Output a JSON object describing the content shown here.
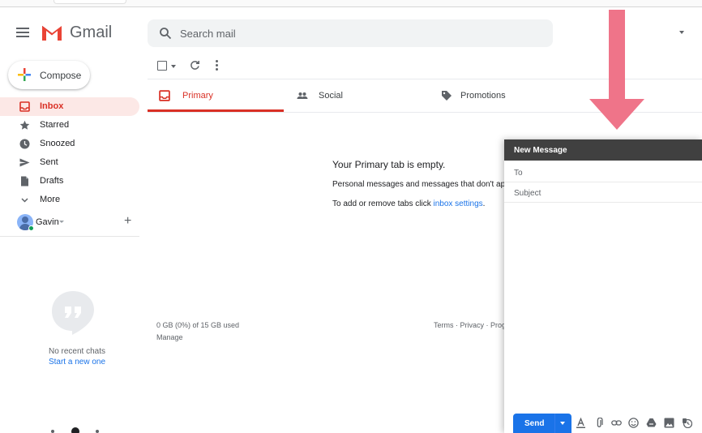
{
  "app": {
    "name": "Gmail"
  },
  "search": {
    "placeholder": "Search mail"
  },
  "compose_button": {
    "label": "Compose"
  },
  "sidebar": {
    "items": [
      {
        "label": "Inbox",
        "icon": "inbox-icon",
        "active": true
      },
      {
        "label": "Starred",
        "icon": "star-icon"
      },
      {
        "label": "Snoozed",
        "icon": "clock-icon"
      },
      {
        "label": "Sent",
        "icon": "send-icon"
      },
      {
        "label": "Drafts",
        "icon": "draft-icon"
      },
      {
        "label": "More",
        "icon": "chevron-down-icon"
      }
    ],
    "user": {
      "name": "Gavin"
    }
  },
  "hangouts": {
    "no_chats": "No recent chats",
    "start_new": "Start a new one"
  },
  "tabs": [
    {
      "label": "Primary",
      "icon": "inbox-icon"
    },
    {
      "label": "Social",
      "icon": "people-icon"
    },
    {
      "label": "Promotions",
      "icon": "tag-icon"
    }
  ],
  "empty": {
    "title": "Your Primary tab is empty.",
    "line1": "Personal messages and messages that don't appear in other tabs will be shown here.",
    "line2_prefix": "To add or remove tabs click ",
    "line2_link": "inbox settings",
    "line2_suffix": "."
  },
  "footer": {
    "storage": "0 GB (0%) of 15 GB used",
    "manage": "Manage",
    "links": [
      "Terms",
      "Privacy",
      "Program Policies"
    ],
    "separator": " · "
  },
  "compose_window": {
    "title": "New Message",
    "to_label": "To",
    "subject_placeholder": "Subject",
    "send_label": "Send"
  },
  "colors": {
    "accent_red": "#d93025",
    "link_blue": "#1a73e8",
    "arrow_pink": "#ef7489"
  }
}
